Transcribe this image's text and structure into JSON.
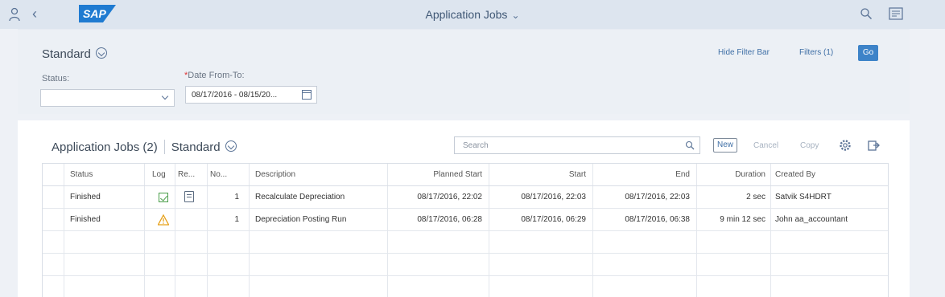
{
  "shell": {
    "logo_text": "SAP",
    "app_title": "Application Jobs",
    "icons": [
      "user-icon",
      "back-icon",
      "chevron-down-icon",
      "search-icon",
      "notifications-icon"
    ]
  },
  "filterbar": {
    "variant": "Standard",
    "status_label": "Status:",
    "status_value": "",
    "date_required_mark": "*",
    "date_label": "Date From-To:",
    "date_value": "08/17/2016 - 08/15/20...",
    "hide_filter_bar": "Hide Filter Bar",
    "filters": "Filters (1)",
    "go": "Go"
  },
  "table": {
    "title": "Application Jobs (2)",
    "variant": "Standard",
    "search_placeholder": "Search",
    "new": "New",
    "cancel": "Cancel",
    "copy": "Copy",
    "columns": [
      "Status",
      "Log",
      "Re...",
      "No...",
      "Description",
      "Planned Start",
      "Start",
      "End",
      "Duration",
      "Created By"
    ],
    "rows": [
      {
        "status": "Finished",
        "log": "success-check-icon",
        "result": "document-icon",
        "number": "1",
        "description": "Recalculate Depreciation",
        "planned_start": "08/17/2016, 22:02",
        "start": "08/17/2016, 22:03",
        "end": "08/17/2016, 22:03",
        "duration": "2 sec",
        "created_by": "Satvik S4HDRT"
      },
      {
        "status": "Finished",
        "log": "warning-icon",
        "result": "",
        "number": "1",
        "description": "Depreciation Posting Run",
        "planned_start": "08/17/2016, 06:28",
        "start": "08/17/2016, 06:29",
        "end": "08/17/2016, 06:38",
        "duration": "9 min 12 sec",
        "created_by": "John aa_accountant"
      }
    ]
  },
  "colors": {
    "shell_bg": "#dde5ef",
    "accent": "#3d83c8",
    "success": "#4b9e4b",
    "warning": "#e6a019"
  }
}
